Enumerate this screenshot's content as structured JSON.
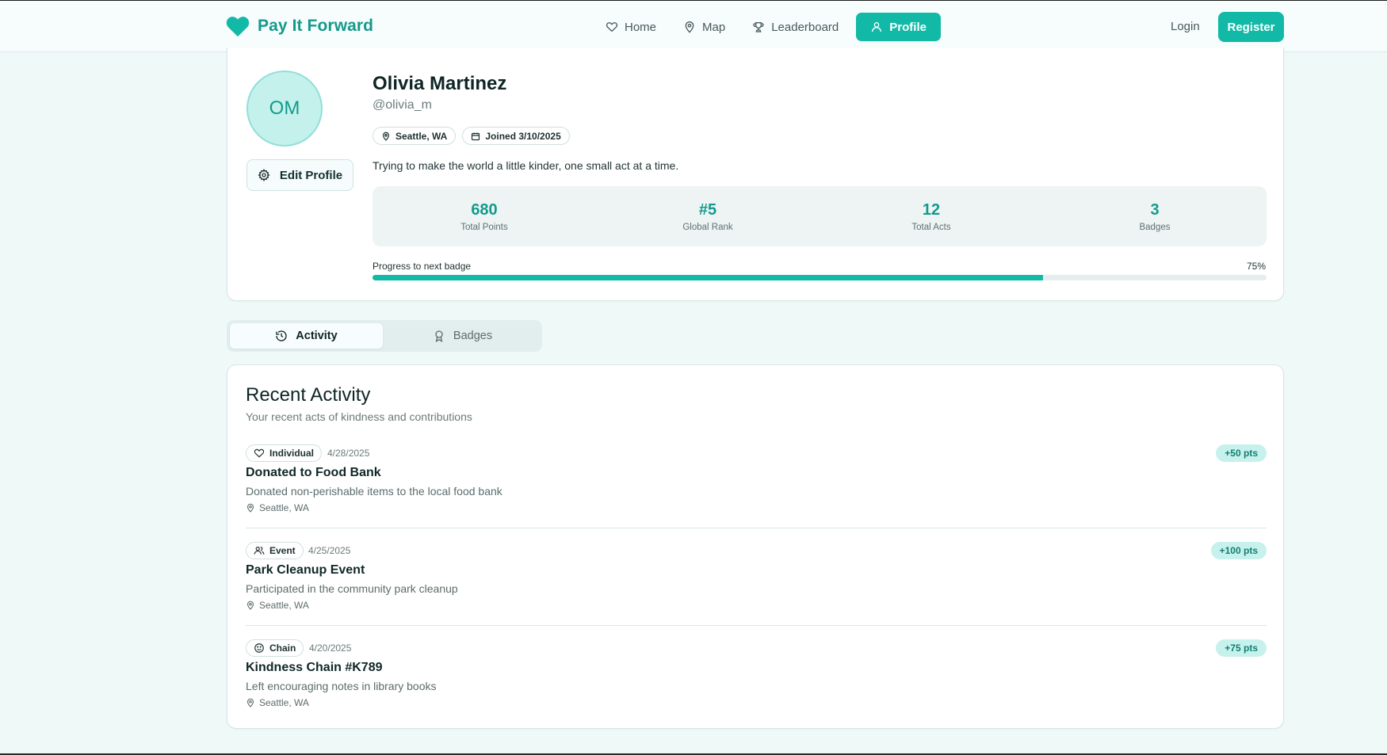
{
  "header": {
    "brand": "Pay It Forward",
    "nav": [
      {
        "label": "Home",
        "icon": "heart-icon"
      },
      {
        "label": "Map",
        "icon": "map-pin-icon"
      },
      {
        "label": "Leaderboard",
        "icon": "trophy-icon"
      },
      {
        "label": "Profile",
        "icon": "user-icon",
        "active": true
      }
    ],
    "login": "Login",
    "register": "Register"
  },
  "profile": {
    "initials": "OM",
    "name": "Olivia Martinez",
    "handle": "@olivia_m",
    "location": "Seattle, WA",
    "joined": "Joined 3/10/2025",
    "bio": "Trying to make the world a little kinder, one small act at a time.",
    "edit_label": "Edit Profile",
    "stats": [
      {
        "value": "680",
        "label": "Total Points"
      },
      {
        "value": "#5",
        "label": "Global Rank"
      },
      {
        "value": "12",
        "label": "Total Acts"
      },
      {
        "value": "3",
        "label": "Badges"
      }
    ],
    "progress": {
      "label": "Progress to next badge",
      "percent_text": "75%",
      "value": 0.75
    }
  },
  "tabs": [
    {
      "label": "Activity",
      "icon": "history-icon",
      "active": true
    },
    {
      "label": "Badges",
      "icon": "award-icon",
      "active": false
    }
  ],
  "activity": {
    "title": "Recent Activity",
    "subtitle": "Your recent acts of kindness and contributions",
    "items": [
      {
        "type": "Individual",
        "icon": "heart-icon",
        "date": "4/28/2025",
        "points": "+50 pts",
        "title": "Donated to Food Bank",
        "description": "Donated non-perishable items to the local food bank",
        "location": "Seattle, WA"
      },
      {
        "type": "Event",
        "icon": "users-icon",
        "date": "4/25/2025",
        "points": "+100 pts",
        "title": "Park Cleanup Event",
        "description": "Participated in the community park cleanup",
        "location": "Seattle, WA"
      },
      {
        "type": "Chain",
        "icon": "smile-icon",
        "date": "4/20/2025",
        "points": "+75 pts",
        "title": "Kindness Chain #K789",
        "description": "Left encouraging notes in library books",
        "location": "Seattle, WA"
      }
    ]
  },
  "colors": {
    "accent": "#12b9a7",
    "brand_text": "#139a8b",
    "background": "#eef9f8"
  }
}
